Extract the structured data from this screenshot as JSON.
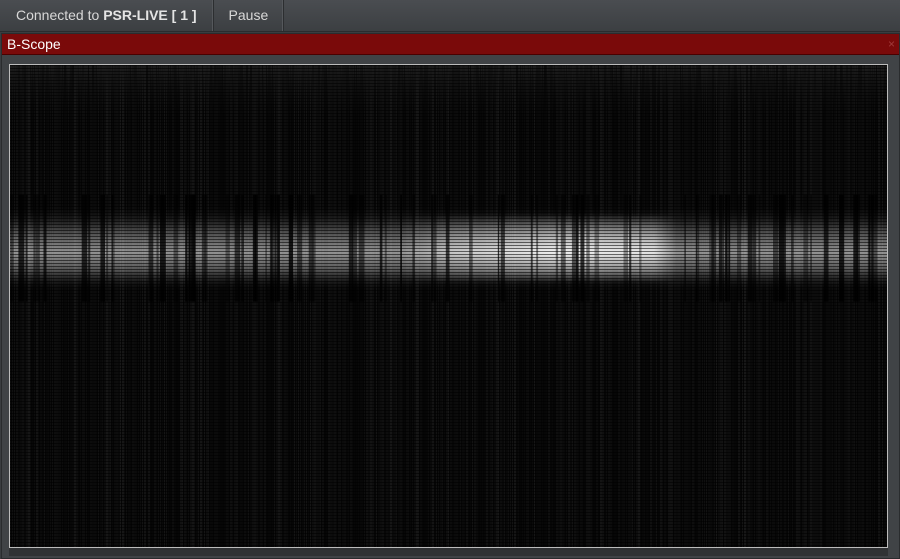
{
  "toolbar": {
    "connected_prefix": "Connected to",
    "connection_name": "PSR-LIVE [ 1 ]",
    "pause_label": "Pause"
  },
  "panel": {
    "title": "B-Scope",
    "close_glyph": "×",
    "header_color": "#7a0a0a"
  },
  "scope": {
    "view": "B-Scope",
    "background_color": "#000000",
    "band_start_fraction": 0.29,
    "band_end_fraction": 0.47,
    "band_peak_fraction": 0.4,
    "bright_region_start_fraction": 0.44,
    "bright_region_end_fraction": 0.76
  }
}
